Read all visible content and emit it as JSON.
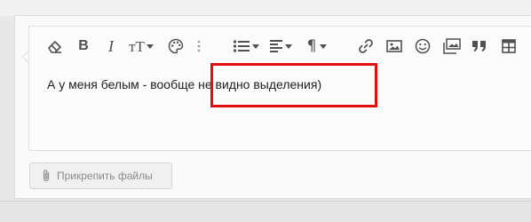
{
  "editor": {
    "content_text": "А у меня белым - вообще не видно выделения)"
  },
  "toolbar": {
    "items": [
      {
        "name": "eraser-icon",
        "label": "Clear formatting"
      },
      {
        "name": "bold-icon",
        "glyph": "B"
      },
      {
        "name": "italic-icon",
        "glyph": "I"
      },
      {
        "name": "font-size-icon",
        "glyph": "тT"
      },
      {
        "name": "palette-icon"
      },
      {
        "name": "more-vertical-icon"
      },
      {
        "name": "list-icon"
      },
      {
        "name": "align-icon"
      },
      {
        "name": "paragraph-icon",
        "glyph": "¶"
      },
      {
        "name": "link-icon"
      },
      {
        "name": "image-icon"
      },
      {
        "name": "smiley-icon"
      },
      {
        "name": "media-icon"
      },
      {
        "name": "quote-icon"
      },
      {
        "name": "table-icon"
      }
    ],
    "bold_glyph": "B",
    "italic_glyph": "I",
    "fontsize_glyph": "тT",
    "paragraph_glyph": "¶"
  },
  "attachments": {
    "button_label": "Прикрепить файлы"
  },
  "colors": {
    "highlight_border": "#e20f0f",
    "icon": "#505050",
    "text": "#1e1e1e",
    "attach_text": "#8a8a8a"
  }
}
